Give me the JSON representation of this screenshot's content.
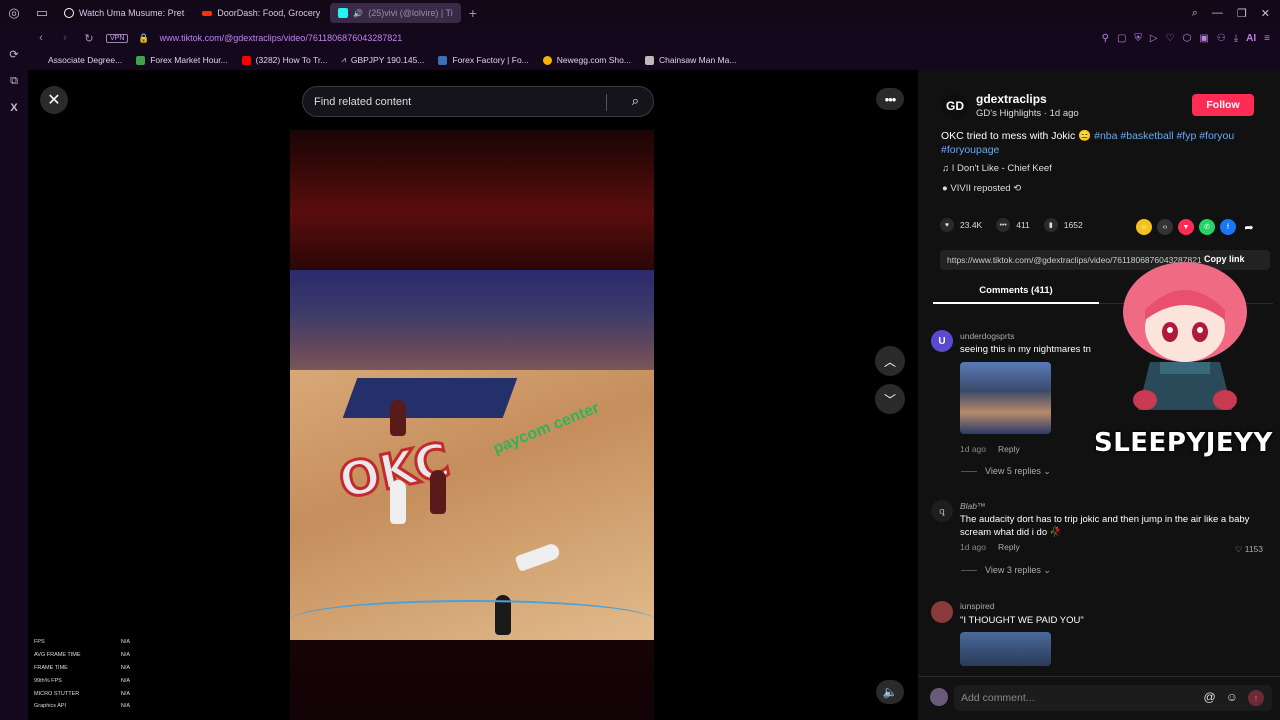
{
  "browser": {
    "tabs": [
      {
        "label": "Watch Uma Musume: Pret",
        "color": "#ffffff"
      },
      {
        "label": "DoorDash: Food, Grocery",
        "color": "#ff3008"
      },
      {
        "label": "(25)vivi (@lolvire) | Ti",
        "color": "#25f4ee"
      }
    ],
    "url": "www.tiktok.com/@gdextraclips/video/7611806876043287821",
    "vpn_label": "VPN",
    "bookmarks": [
      {
        "label": "Associate Degree...",
        "color": "#4a90e2"
      },
      {
        "label": "Forex Market Hour...",
        "color": "#3fa34d"
      },
      {
        "label": "(3282) How To Tr...",
        "color": "#ff0000"
      },
      {
        "label": "GBPJPY 190.145...",
        "color": "#ffffff"
      },
      {
        "label": "Forex Factory | Fo...",
        "color": "#3b6fb6"
      },
      {
        "label": "Newegg.com Sho...",
        "color": "#f7b500"
      },
      {
        "label": "Chainsaw Man Ma...",
        "color": "#bbbbbb"
      }
    ],
    "ai_label": "AI"
  },
  "player": {
    "search_placeholder": "Find related content",
    "court_text": "OKC",
    "sponsor_text": "paycom center",
    "perf_overlay": [
      {
        "label": "FPS",
        "value": "N/A"
      },
      {
        "label": "AVG FRAME TIME",
        "value": "N/A"
      },
      {
        "label": "FRAME TIME",
        "value": "N/A"
      },
      {
        "label": "99th% FPS",
        "value": "N/A"
      },
      {
        "label": "MICRO STUTTER",
        "value": "N/A"
      },
      {
        "label": "Graphics API",
        "value": "N/A"
      }
    ]
  },
  "post": {
    "author_initials": "GD",
    "author": "gdextraclips",
    "author_sub": "GD's Highlights · 1d ago",
    "follow_label": "Follow",
    "caption_text": "OKC tried to mess with Jokic 😑 ",
    "hashtags": "#nba #basketball #fyp #foryou #foryoupage",
    "music": "I Don't Like - Chief Keef",
    "repost": "VIVII reposted",
    "likes": "23.4K",
    "comments_count": "411",
    "saves": "1652",
    "link": "https://www.tiktok.com/@gdextraclips/video/7611806876043287821",
    "copy_link_label": "Copy link",
    "tab_comments": "Comments (411)",
    "share_colors": [
      "#f4c21a",
      "#333333",
      "#fe2c55",
      "#25d366",
      "#1877f2"
    ]
  },
  "comments": [
    {
      "user": "underdogsprts",
      "text": "seeing this in my nightmares tn",
      "time": "1d ago",
      "reply": "Reply",
      "replies": "View 5 replies ⌄",
      "likes": "",
      "avatar_color": "#5a4ad0"
    },
    {
      "user": "Blab™",
      "text": "The audacity dort has to trip jokic and then jump in the air like a baby scream what did i do 🥀",
      "time": "1d ago",
      "reply": "Reply",
      "replies": "View 3 replies ⌄",
      "likes": "1153",
      "avatar_color": "#1e1e1e"
    },
    {
      "user": "iunspired",
      "text": "\"I THOUGHT WE PAID YOU\"",
      "time": "",
      "reply": "",
      "replies": "",
      "likes": "",
      "avatar_color": "#8a3a3a"
    }
  ],
  "add_comment_placeholder": "Add comment...",
  "streamer_watermark": "SLEEPYJEYY"
}
